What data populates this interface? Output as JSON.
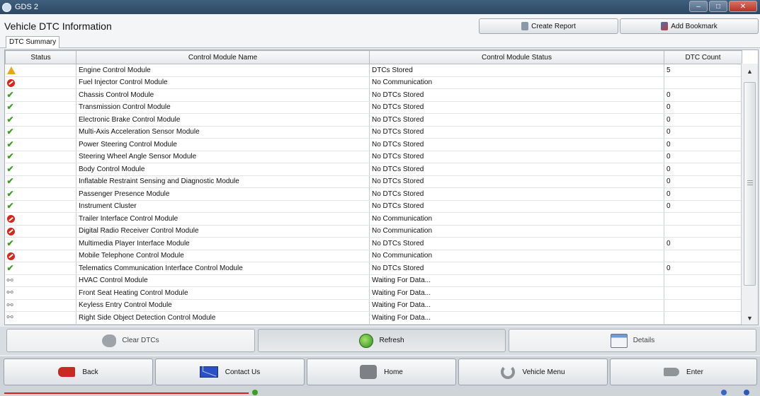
{
  "window": {
    "title": "GDS 2",
    "minimize": "–",
    "maximize": "□",
    "close": "✕"
  },
  "page": {
    "title": "Vehicle DTC Information",
    "create_report": "Create Report",
    "add_bookmark": "Add Bookmark"
  },
  "tabs": [
    {
      "label": "DTC Summary",
      "active": true
    }
  ],
  "table": {
    "headers": [
      "Status",
      "Control Module Name",
      "Control Module Status",
      "DTC Count"
    ],
    "rows": [
      {
        "icon": "warning-icon",
        "name": "Engine Control Module",
        "status": "DTCs Stored",
        "count": "5"
      },
      {
        "icon": "no-communication-icon",
        "name": "Fuel Injector Control Module",
        "status": "No Communication",
        "count": ""
      },
      {
        "icon": "checkmark-icon",
        "name": "Chassis Control Module",
        "status": "No DTCs Stored",
        "count": "0"
      },
      {
        "icon": "checkmark-icon",
        "name": "Transmission Control Module",
        "status": "No DTCs Stored",
        "count": "0"
      },
      {
        "icon": "checkmark-icon",
        "name": "Electronic Brake Control Module",
        "status": "No DTCs Stored",
        "count": "0"
      },
      {
        "icon": "checkmark-icon",
        "name": "Multi-Axis Acceleration Sensor Module",
        "status": "No DTCs Stored",
        "count": "0"
      },
      {
        "icon": "checkmark-icon",
        "name": "Power Steering Control Module",
        "status": "No DTCs Stored",
        "count": "0"
      },
      {
        "icon": "checkmark-icon",
        "name": "Steering Wheel Angle Sensor Module",
        "status": "No DTCs Stored",
        "count": "0"
      },
      {
        "icon": "checkmark-icon",
        "name": "Body Control Module",
        "status": "No DTCs Stored",
        "count": "0"
      },
      {
        "icon": "checkmark-icon",
        "name": "Inflatable Restraint Sensing and Diagnostic Module",
        "status": "No DTCs Stored",
        "count": "0"
      },
      {
        "icon": "checkmark-icon",
        "name": "Passenger Presence Module",
        "status": "No DTCs Stored",
        "count": "0"
      },
      {
        "icon": "checkmark-icon",
        "name": "Instrument Cluster",
        "status": "No DTCs Stored",
        "count": "0"
      },
      {
        "icon": "no-communication-icon",
        "name": "Trailer Interface Control Module",
        "status": "No Communication",
        "count": ""
      },
      {
        "icon": "no-communication-icon",
        "name": "Digital Radio Receiver Control Module",
        "status": "No Communication",
        "count": ""
      },
      {
        "icon": "checkmark-icon",
        "name": "Multimedia Player Interface Module",
        "status": "No DTCs Stored",
        "count": "0"
      },
      {
        "icon": "no-communication-icon",
        "name": "Mobile Telephone Control Module",
        "status": "No Communication",
        "count": ""
      },
      {
        "icon": "checkmark-icon",
        "name": "Telematics Communication Interface Control Module",
        "status": "No DTCs Stored",
        "count": "0"
      },
      {
        "icon": "plug-icon",
        "name": "HVAC Control Module",
        "status": "Waiting For Data...",
        "count": ""
      },
      {
        "icon": "plug-icon",
        "name": "Front Seat Heating Control Module",
        "status": "Waiting For Data...",
        "count": ""
      },
      {
        "icon": "plug-icon",
        "name": "Keyless Entry Control Module",
        "status": "Waiting For Data...",
        "count": ""
      },
      {
        "icon": "plug-icon",
        "name": "Right Side Object Detection Control Module",
        "status": "Waiting For Data...",
        "count": ""
      }
    ]
  },
  "actions": {
    "clear_dtcs": "Clear DTCs",
    "refresh": "Refresh",
    "details": "Details"
  },
  "nav": {
    "back": "Back",
    "contact_us": "Contact Us",
    "home": "Home",
    "vehicle_menu": "Vehicle Menu",
    "enter": "Enter"
  },
  "colors": {
    "ok": "#3c9e25",
    "error": "#d8261b",
    "warning": "#e9a719",
    "titlebar": "#2c4863"
  }
}
